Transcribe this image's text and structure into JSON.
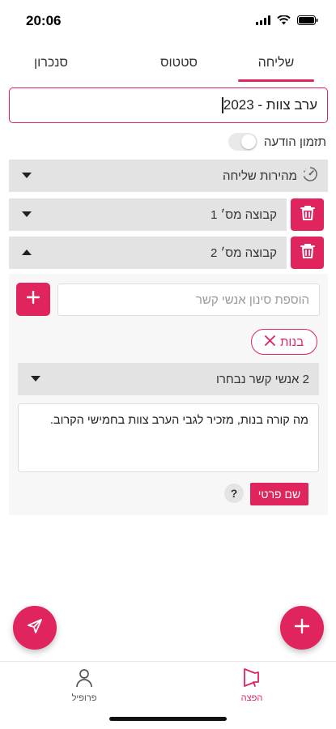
{
  "status_bar": {
    "time": "20:06"
  },
  "tabs": [
    {
      "label": "שליחה",
      "active": true
    },
    {
      "label": "סטטוס",
      "active": false
    },
    {
      "label": "סנכרון",
      "active": false
    }
  ],
  "title_input": {
    "value": "ערב צוות - 2023"
  },
  "schedule_toggle": {
    "label": "תזמון הודעה",
    "on": false
  },
  "send_speed": {
    "label": "מהירות שליחה"
  },
  "groups": [
    {
      "label": "קבוצה מס׳ 1",
      "expanded": false
    },
    {
      "label": "קבוצה מס׳ 2",
      "expanded": true
    }
  ],
  "contact_filter": {
    "placeholder": "הוספת סינון אנשי קשר"
  },
  "filter_chip": {
    "label": "בנות"
  },
  "selected_contacts": {
    "label": "2 אנשי קשר נבחרו"
  },
  "message": {
    "text": "מה קורה בנות, מזכיר לגבי הערב צוות בחמישי הקרוב."
  },
  "personal_name_button": {
    "label": "שם פרטי"
  },
  "help_button": {
    "label": "?"
  },
  "bottom_nav": {
    "items": [
      {
        "label": "פרופיל",
        "icon": "profile-icon",
        "active": false
      },
      {
        "label": "הפצה",
        "icon": "megaphone-icon",
        "active": true
      }
    ]
  },
  "colors": {
    "accent": "#e0245e",
    "accordion_bg": "#e3e3e3",
    "panel_bg": "#f7f7f7"
  }
}
